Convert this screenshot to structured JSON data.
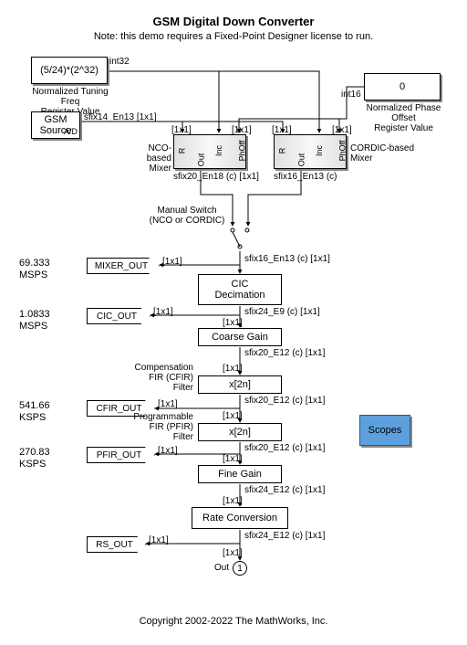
{
  "title": "GSM Digital Down Converter",
  "subtitle": "Note: this demo requires a Fixed-Point Designer license to run.",
  "tuning_freq": {
    "expr": "(5/24)*(2^32)",
    "label": "Normalized Tuning Freq\nRegister Value",
    "type": "int32"
  },
  "phase_offset": {
    "value": "0",
    "label": "Normalized Phase Offset\nRegister Value",
    "type": "int16"
  },
  "gsm_source": {
    "label": "GSM\nSource",
    "port": "A/D",
    "type": "sfix14_En13",
    "dims": "[1x1]"
  },
  "mixers": {
    "nco": {
      "label": "NCO-based\nMixer",
      "out_type": "sfix20_En18 (c)",
      "dims": "[1x1]",
      "ports": {
        "r": "R",
        "out": "Out",
        "inc": "Inc",
        "phoff": "PhOff"
      }
    },
    "cordic": {
      "label": "CORDIC-based\nMixer",
      "out_type": "sfix16_En13 (c)",
      "ports": {
        "r": "R",
        "out": "Out",
        "inc": "Inc",
        "phoff": "PhOff"
      }
    }
  },
  "switch": {
    "label": "Manual Switch\n(NCO or CORDIC)",
    "out_type": "sfix16_En13 (c)",
    "dims": "[1x1]"
  },
  "chain": {
    "cic": {
      "label": "CIC\nDecimation",
      "out_type": "sfix24_E9 (c)",
      "dims": "[1x1]"
    },
    "coarse": {
      "label": "Coarse Gain",
      "out_type": "sfix20_E12 (c)",
      "dims": "[1x1]"
    },
    "cfir": {
      "label": "x[2n]",
      "out_type": "sfix20_E12 (c)",
      "dims": "[1x1]",
      "title": "Compensation\nFIR (CFIR) Filter"
    },
    "pfir": {
      "label": "x[2n]",
      "out_type": "sfix20_E12 (c)",
      "dims": "[1x1]",
      "title": "Programmable\nFIR (PFIR) Filter"
    },
    "fine": {
      "label": "Fine Gain",
      "out_type": "sfix24_E12 (c)",
      "dims": "[1x1]"
    },
    "rate": {
      "label": "Rate Conversion",
      "out_type": "sfix24_E12 (c)",
      "dims": "[1x1]"
    }
  },
  "rates": {
    "mixer": "69.333\nMSPS",
    "cic": "1.0833\nMSPS",
    "cfir": "541.66\nKSPS",
    "pfir": "270.83\nKSPS"
  },
  "tags": {
    "mixer": "MIXER_OUT",
    "cic": "CIC_OUT",
    "cfir": "CFIR_OUT",
    "pfir": "PFIR_OUT",
    "rs": "RS_OUT"
  },
  "scopes": "Scopes",
  "out": {
    "label": "Out",
    "num": "1"
  },
  "in_dims": "[1x1]",
  "footer": "Copyright 2002-2022 The MathWorks, Inc."
}
